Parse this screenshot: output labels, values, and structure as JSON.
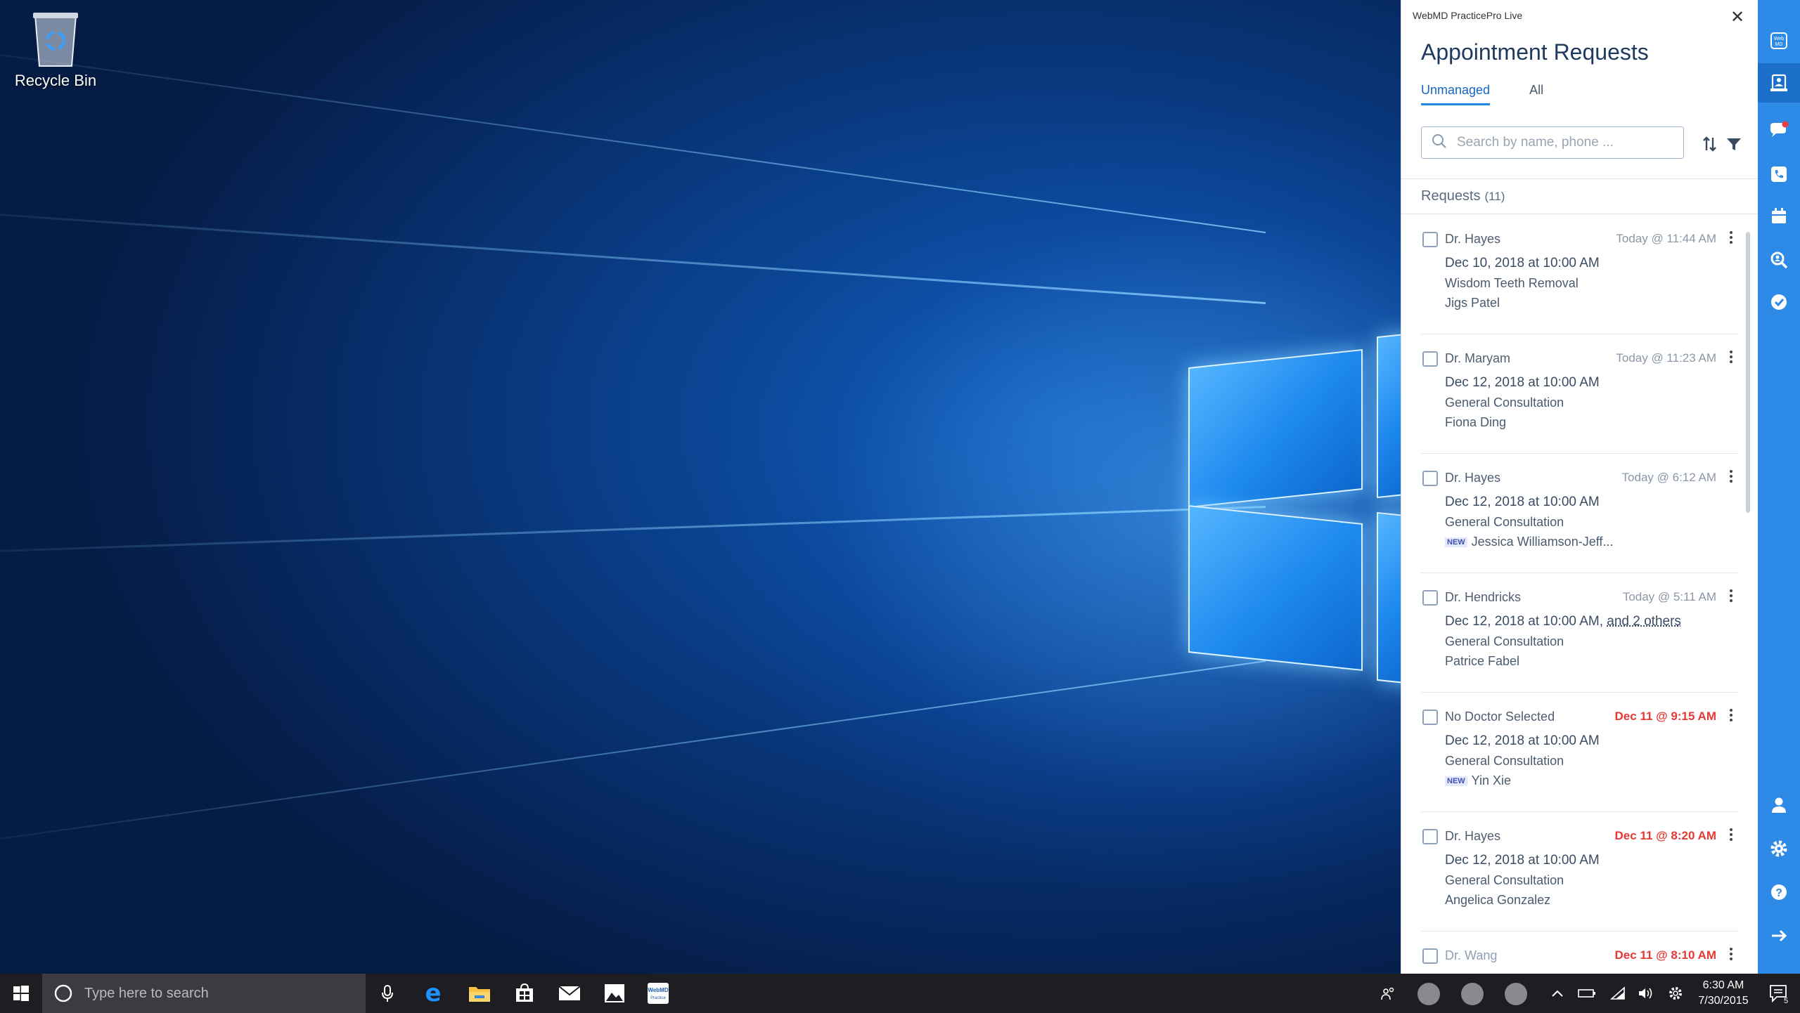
{
  "desktop": {
    "recycle_bin_label": "Recycle Bin"
  },
  "panel": {
    "app_title": "WebMD PracticePro Live",
    "page_title": "Appointment Requests",
    "tabs": [
      {
        "label": "Unmanaged",
        "active": true
      },
      {
        "label": "All",
        "active": false
      }
    ],
    "search_placeholder": "Search by name, phone ...",
    "requests_label": "Requests",
    "requests_count": "(11)",
    "items": [
      {
        "doctor": "Dr. Hayes",
        "time": "Today @ 11:44 AM",
        "time_color": "gray",
        "date": "Dec 10, 2018 at 10:00 AM",
        "date_extra": "",
        "service": "Wisdom Teeth Removal",
        "patient": "Jigs Patel",
        "new": ""
      },
      {
        "doctor": "Dr. Maryam",
        "time": "Today @ 11:23 AM",
        "time_color": "gray",
        "date": "Dec 12, 2018 at 10:00 AM",
        "date_extra": "",
        "service": "General Consultation",
        "patient": "Fiona Ding",
        "new": ""
      },
      {
        "doctor": "Dr. Hayes",
        "time": "Today @ 6:12 AM",
        "time_color": "gray",
        "date": "Dec 12, 2018 at 10:00 AM",
        "date_extra": "",
        "service": "General Consultation",
        "patient": "Jessica Williamson-Jeff...",
        "new": "NEW"
      },
      {
        "doctor": "Dr. Hendricks",
        "time": "Today @ 5:11 AM",
        "time_color": "gray",
        "date": "Dec 12, 2018 at 10:00 AM,",
        "date_extra": "and 2 others",
        "service": "General Consultation",
        "patient": "Patrice Fabel",
        "new": ""
      },
      {
        "doctor": "No Doctor Selected",
        "time": "Dec 11 @ 9:15 AM",
        "time_color": "red",
        "date": "Dec 12, 2018 at 10:00 AM",
        "date_extra": "",
        "service": "General Consultation",
        "patient": "Yin Xie",
        "new": "NEW"
      },
      {
        "doctor": "Dr. Hayes",
        "time": "Dec 11 @ 8:20 AM",
        "time_color": "red",
        "date": "Dec 12, 2018 at 10:00 AM",
        "date_extra": "",
        "service": "General Consultation",
        "patient": "Angelica Gonzalez",
        "new": ""
      },
      {
        "doctor": "Dr. Wang",
        "time": "Dec 11 @ 8:10 AM",
        "time_color": "red",
        "date": "",
        "date_extra": "",
        "service": "",
        "patient": "",
        "new": ""
      }
    ]
  },
  "rail": {
    "icons": [
      "webmd-logo-icon",
      "appointment-requests-icon",
      "chat-icon",
      "phone-icon",
      "calendar-icon",
      "search-patient-icon",
      "check-icon",
      "user-icon",
      "settings-icon",
      "help-icon",
      "exit-icon"
    ],
    "active": "appointment-requests-icon",
    "accent": "#2d8ae6"
  },
  "taskbar": {
    "search_placeholder": "Type here to search",
    "time": "6:30 AM",
    "date": "7/30/2015",
    "notification_count": "5",
    "webmd_tile_label": "WebMD PracticePro"
  }
}
